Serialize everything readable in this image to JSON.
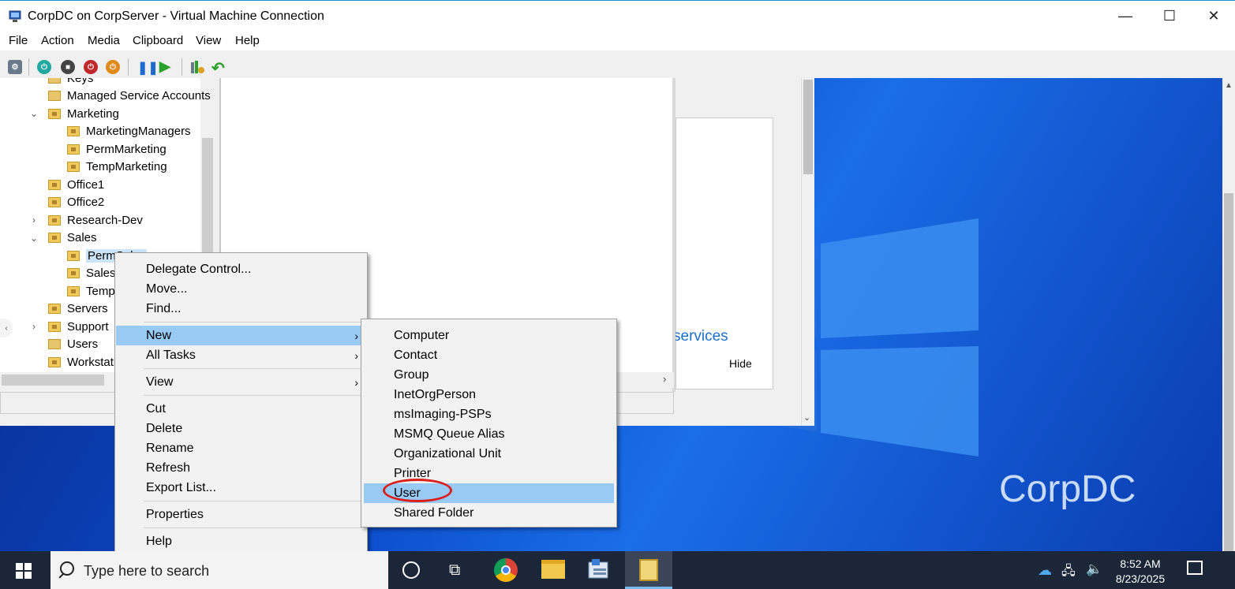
{
  "window": {
    "title": "CorpDC on CorpServer - Virtual Machine Connection",
    "minimize_glyph": "—",
    "maximize_glyph": "☐",
    "close_glyph": "✕"
  },
  "menubar": [
    "File",
    "Action",
    "Media",
    "Clipboard",
    "View",
    "Help"
  ],
  "toolbar_icons": [
    "ctrl-alt-del-icon",
    "start-icon",
    "turn-off-icon",
    "shutdown-icon",
    "save-icon",
    "pause-icon",
    "resume-icon",
    "checkpoint-icon",
    "revert-icon"
  ],
  "tree": {
    "items": [
      {
        "label": "Keys",
        "indent": 0,
        "expander": "",
        "type": "folder"
      },
      {
        "label": "Managed Service Accounts",
        "indent": 0,
        "expander": "",
        "type": "folder"
      },
      {
        "label": "Marketing",
        "indent": 0,
        "expander": "expanded",
        "type": "ou"
      },
      {
        "label": "MarketingManagers",
        "indent": 1,
        "expander": "",
        "type": "ou"
      },
      {
        "label": "PermMarketing",
        "indent": 1,
        "expander": "",
        "type": "ou"
      },
      {
        "label": "TempMarketing",
        "indent": 1,
        "expander": "",
        "type": "ou"
      },
      {
        "label": "Office1",
        "indent": 0,
        "expander": "",
        "type": "ou"
      },
      {
        "label": "Office2",
        "indent": 0,
        "expander": "",
        "type": "ou"
      },
      {
        "label": "Research-Dev",
        "indent": 0,
        "expander": "collapsed",
        "type": "ou"
      },
      {
        "label": "Sales",
        "indent": 0,
        "expander": "expanded",
        "type": "ou"
      },
      {
        "label": "PermSales",
        "indent": 1,
        "expander": "",
        "type": "ou",
        "selected": true
      },
      {
        "label": "SalesM",
        "indent": 1,
        "expander": "",
        "type": "ou"
      },
      {
        "label": "TempSales",
        "indent": 1,
        "expander": "",
        "type": "ou"
      },
      {
        "label": "Servers",
        "indent": 0,
        "expander": "",
        "type": "ou"
      },
      {
        "label": "Support",
        "indent": 0,
        "expander": "collapsed",
        "type": "ou"
      },
      {
        "label": "Users",
        "indent": 0,
        "expander": "",
        "type": "folder"
      },
      {
        "label": "Workstations",
        "indent": 0,
        "expander": "",
        "type": "ou"
      }
    ]
  },
  "server_manager_panel": {
    "link": "services",
    "hide": "Hide"
  },
  "context_menu": {
    "items": [
      {
        "label": "Delegate Control...",
        "submenu": false
      },
      {
        "label": "Move...",
        "submenu": false
      },
      {
        "label": "Find...",
        "submenu": false
      },
      {
        "sep": true
      },
      {
        "label": "New",
        "submenu": true,
        "highlighted": true
      },
      {
        "label": "All Tasks",
        "submenu": true
      },
      {
        "sep": true
      },
      {
        "label": "View",
        "submenu": true
      },
      {
        "sep": true
      },
      {
        "label": "Cut",
        "submenu": false
      },
      {
        "label": "Delete",
        "submenu": false
      },
      {
        "label": "Rename",
        "submenu": false
      },
      {
        "label": "Refresh",
        "submenu": false
      },
      {
        "label": "Export List...",
        "submenu": false
      },
      {
        "sep": true
      },
      {
        "label": "Properties",
        "submenu": false
      },
      {
        "sep": true
      },
      {
        "label": "Help",
        "submenu": false
      }
    ]
  },
  "new_submenu": {
    "items": [
      "Computer",
      "Contact",
      "Group",
      "InetOrgPerson",
      "msImaging-PSPs",
      "MSMQ Queue Alias",
      "Organizational Unit",
      "Printer",
      "User",
      "Shared Folder"
    ],
    "highlighted": "User"
  },
  "desktop": {
    "watermark": "CorpDC"
  },
  "taskbar": {
    "search_placeholder": "Type here to search",
    "time": "8:52 AM",
    "date": "8/23/2025"
  },
  "colors": {
    "highlight": "#99c9f5",
    "annotation_circle": "#d9201c",
    "taskbar": "#1b2638"
  }
}
